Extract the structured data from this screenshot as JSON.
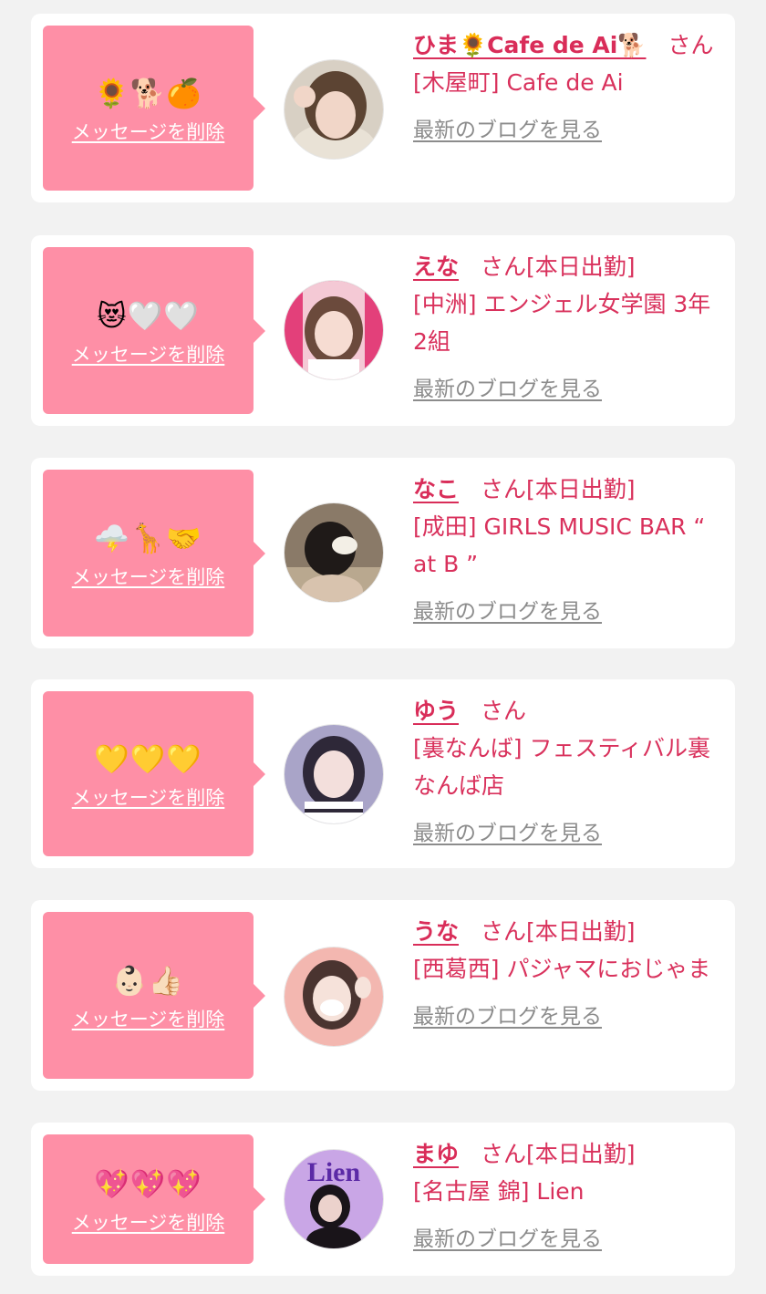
{
  "messages": [
    {
      "stamp": "🌻🐕🍊",
      "delete_label": "メッセージを削除",
      "name": "ひま🌻Cafe de Ai🐕",
      "honorific": "さん",
      "status": "",
      "shop": "[木屋町] Cafe de Ai",
      "blog_label": "最新のブログを見る",
      "avatar_colors": {
        "bg": "#d8d0c4",
        "hair": "#5c4433",
        "skin": "#f1d6c8",
        "accent": "#e9e2d6"
      }
    },
    {
      "stamp": "😻🤍🤍",
      "delete_label": "メッセージを削除",
      "name": "えな",
      "honorific": "さん",
      "status": "[本日出勤]",
      "shop": "[中洲] エンジェル女学園 3年2組",
      "blog_label": "最新のブログを見る",
      "avatar_colors": {
        "bg": "#e3407a",
        "hair": "#6b4a3c",
        "skin": "#f6dcd2",
        "accent": "#ffffff"
      }
    },
    {
      "stamp": "🌩️🦒🤝",
      "delete_label": "メッセージを削除",
      "name": "なこ",
      "honorific": "さん",
      "status": "[本日出勤]",
      "shop": "[成田] GIRLS MUSIC BAR “ at B ”",
      "blog_label": "最新のブログを見る",
      "avatar_colors": {
        "bg": "#8a7a68",
        "hair": "#1f1a18",
        "skin": "#d8c3ae",
        "accent": "#f3efe6"
      }
    },
    {
      "stamp": "💛💛💛",
      "delete_label": "メッセージを削除",
      "name": "ゆう",
      "honorific": "さん",
      "status": "",
      "shop": "[裏なんば] フェスティバル裏なんば店",
      "blog_label": "最新のブログを見る",
      "avatar_colors": {
        "bg": "#a9a4c8",
        "hair": "#2e2838",
        "skin": "#f3dfdc",
        "accent": "#ffffff"
      }
    },
    {
      "stamp": "👶🏻👍🏻",
      "delete_label": "メッセージを削除",
      "name": "うな",
      "honorific": "さん",
      "status": "[本日出勤]",
      "shop": "[西葛西] パジャマにおじゃま",
      "blog_label": "最新のブログを見る",
      "avatar_colors": {
        "bg": "#f3b7b0",
        "hair": "#4a3430",
        "skin": "#f6e2da",
        "accent": "#ffffff"
      }
    },
    {
      "stamp": "💖💖💖",
      "delete_label": "メッセージを削除",
      "name": "まゆ",
      "honorific": "さん",
      "status": "[本日出勤]",
      "shop": "[名古屋 錦] Lien",
      "blog_label": "最新のブログを見る",
      "avatar_colors": {
        "bg": "#c9a6e6",
        "hair": "#191419",
        "skin": "#ecd2cc",
        "accent": "#5b2aa6"
      },
      "avatar_text": "Lien"
    }
  ]
}
